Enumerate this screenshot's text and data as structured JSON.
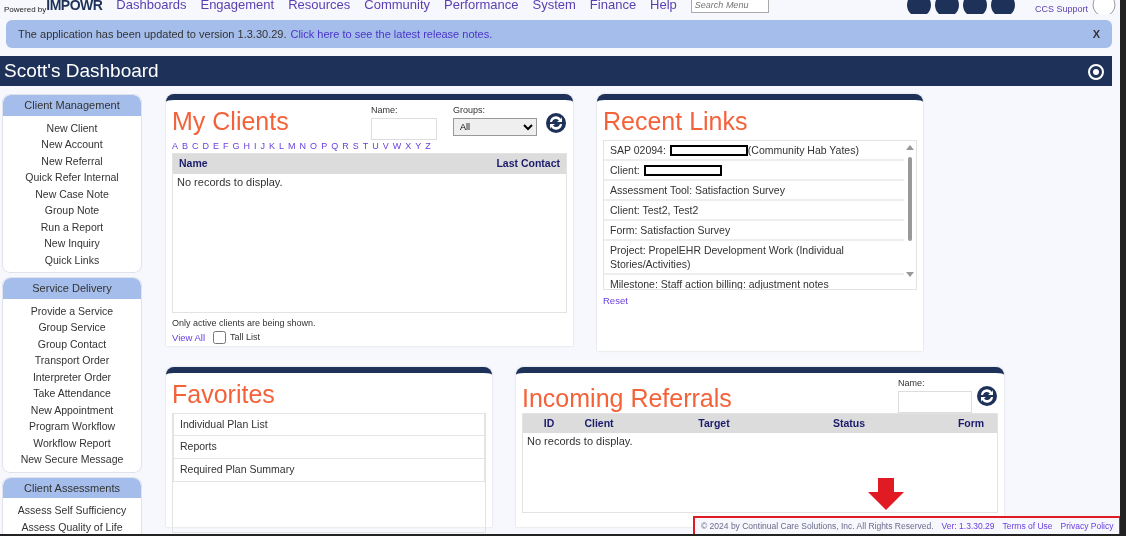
{
  "top_nav": {
    "brand_prefix": "Powered by",
    "brand": "IMPOWR",
    "menu": [
      "Dashboards",
      "Engagement",
      "Resources",
      "Community",
      "Performance",
      "System",
      "Finance",
      "Help"
    ],
    "search": {
      "placeholder": "Search Menu"
    },
    "support_link": "CCS Support"
  },
  "alert": {
    "text": "The application has been updated to version 1.3.30.29.",
    "link": "Click here to see the latest release notes.",
    "close": "X"
  },
  "dashboard": {
    "title": "Scott's Dashboard"
  },
  "sidebar": [
    {
      "title": "Client Management",
      "items": [
        "New Client",
        "New Account",
        "New Referral",
        "Quick Refer Internal",
        "New Case Note",
        "Group Note",
        "Run a Report",
        "New Inquiry",
        "Quick Links"
      ]
    },
    {
      "title": "Service Delivery",
      "items": [
        "Provide a Service",
        "Group Service",
        "Group Contact",
        "Transport Order",
        "Interpreter Order",
        "Take Attendance",
        "New Appointment",
        "Program Workflow",
        "Workflow Report",
        "New Secure Message"
      ]
    },
    {
      "title": "Client Assessments",
      "items": [
        "Assess Self Sufficiency",
        "Assess Quality of Life"
      ]
    }
  ],
  "my_clients": {
    "title": "My Clients",
    "name_label": "Name:",
    "groups_label": "Groups:",
    "groups_value": "All",
    "letters": [
      "A",
      "B",
      "C",
      "D",
      "E",
      "F",
      "G",
      "H",
      "I",
      "J",
      "K",
      "L",
      "M",
      "N",
      "O",
      "P",
      "Q",
      "R",
      "S",
      "T",
      "U",
      "V",
      "W",
      "X",
      "Y",
      "Z"
    ],
    "columns": [
      "Name",
      "Last Contact"
    ],
    "empty": "No records to display.",
    "note": "Only active clients are being shown.",
    "view_all": "View All",
    "tall_list": {
      "label": "Tall List",
      "checked": false
    }
  },
  "recent_links": {
    "title": "Recent Links",
    "items": [
      {
        "text": "SAP 02094:",
        "redacted": true,
        "after": "(Community Hab Yates)"
      },
      {
        "text": "Client:",
        "redacted": true
      },
      {
        "text": "Assessment Tool: Satisfaction Survey",
        "redacted": false
      },
      {
        "text": "Client: Test2, Test2",
        "redacted": false
      },
      {
        "text": "Form: Satisfaction Survey",
        "redacted": false
      },
      {
        "text": "Project: PropelEHR Development Work (Individual Stories/Activities)",
        "redacted": false
      },
      {
        "text": "Milestone: Staff action billing: adjustment notes",
        "redacted": false
      }
    ],
    "reset": "Reset"
  },
  "favorites": {
    "title": "Favorites",
    "items": [
      "Individual Plan List",
      "Reports",
      "Required Plan Summary"
    ]
  },
  "incoming_referrals": {
    "title": "Incoming Referrals",
    "name_label": "Name:",
    "columns": [
      "ID",
      "Client",
      "Target",
      "Status",
      "Form"
    ],
    "empty": "No records to display."
  },
  "footer": {
    "copyright": "© 2024 by Continual Care Solutions, Inc. All Rights Reserved.",
    "version": "Ver: 1.3.30.29",
    "links": [
      "Terms of Use",
      "Privacy Policy"
    ]
  }
}
